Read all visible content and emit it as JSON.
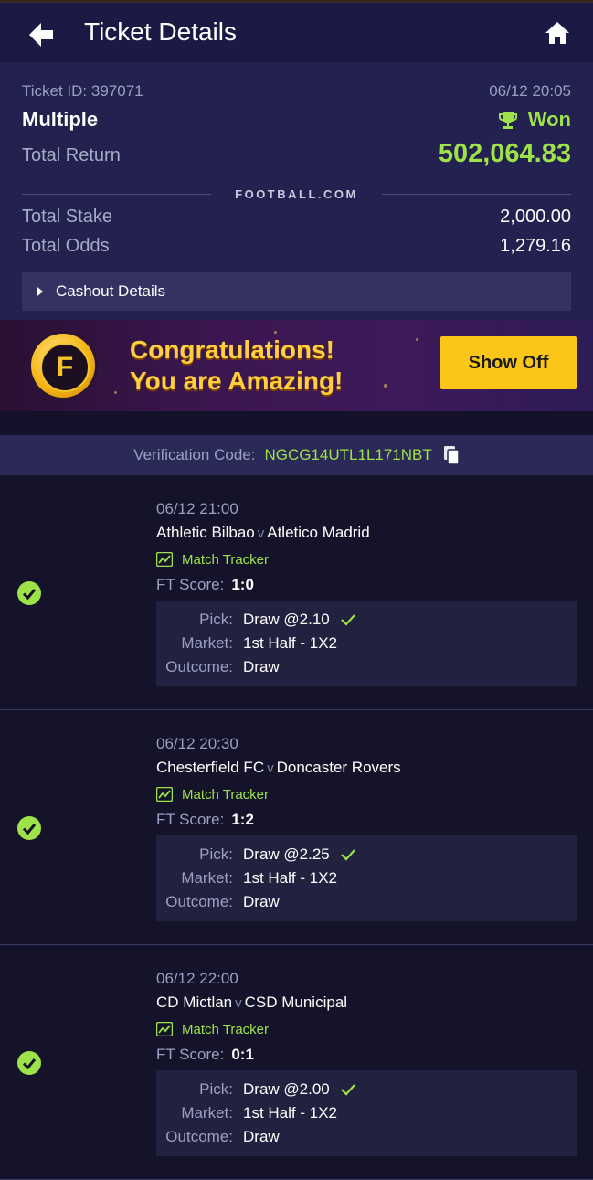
{
  "header": {
    "title": "Ticket Details"
  },
  "ticket": {
    "id_label": "Ticket ID: 397071",
    "datetime": "06/12 20:05",
    "type": "Multiple",
    "status": "Won",
    "total_return_label": "Total Return",
    "total_return": "502,064.83",
    "brand": "FOOTBALL",
    "brand_dot": ".",
    "brand_tld": "COM",
    "total_stake_label": "Total Stake",
    "total_stake": "2,000.00",
    "total_odds_label": "Total Odds",
    "total_odds": "1,279.16",
    "cashout_label": "Cashout Details"
  },
  "banner": {
    "logo_letter": "F",
    "line1": "Congratulations!",
    "line2": "You are Amazing!",
    "button": "Show Off"
  },
  "verification": {
    "label": "Verification Code:",
    "code": "NGCG14UTL1L171NBT"
  },
  "events": [
    {
      "datetime": "06/12 21:00",
      "home": "Athletic Bilbao",
      "vs": "v",
      "away": "Atletico Madrid",
      "tracker": "Match Tracker",
      "ft_label": "FT Score:",
      "ft": "1:0",
      "pick_label": "Pick:",
      "pick": "Draw @2.10",
      "market_label": "Market:",
      "market": "1st Half - 1X2",
      "outcome_label": "Outcome:",
      "outcome": "Draw"
    },
    {
      "datetime": "06/12 20:30",
      "home": "Chesterfield FC",
      "vs": "v",
      "away": "Doncaster Rovers",
      "tracker": "Match Tracker",
      "ft_label": "FT Score:",
      "ft": "1:2",
      "pick_label": "Pick:",
      "pick": "Draw @2.25",
      "market_label": "Market:",
      "market": "1st Half - 1X2",
      "outcome_label": "Outcome:",
      "outcome": "Draw"
    },
    {
      "datetime": "06/12 22:00",
      "home": "CD Mictlan",
      "vs": "v",
      "away": "CSD Municipal",
      "tracker": "Match Tracker",
      "ft_label": "FT Score:",
      "ft": "0:1",
      "pick_label": "Pick:",
      "pick": "Draw @2.00",
      "market_label": "Market:",
      "market": "1st Half - 1X2",
      "outcome_label": "Outcome:",
      "outcome": "Draw"
    }
  ],
  "colors": {
    "accent_green": "#9ee24a",
    "header_bg": "#1b1a44",
    "summary_bg": "#23214f",
    "button_yellow": "#fbc618"
  },
  "icons": {
    "back": "arrow-left-icon",
    "home": "home-icon",
    "trophy": "trophy-icon",
    "copy": "copy-icon",
    "check": "check-circle-icon",
    "tracker": "chart-line-icon"
  }
}
